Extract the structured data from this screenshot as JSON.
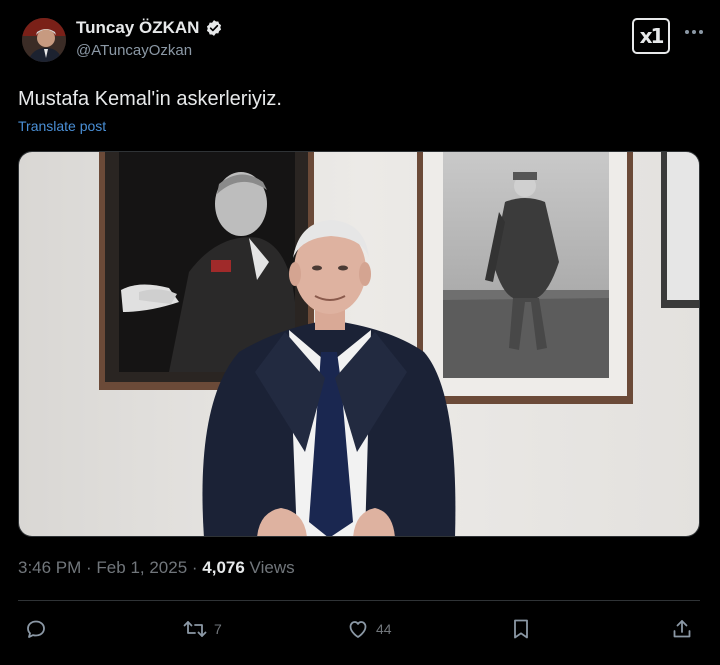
{
  "author": {
    "display_name": "Tuncay ÖZKAN",
    "handle": "@ATuncayOzkan",
    "verified": true,
    "verified_color": "#ffffff"
  },
  "header_actions": {
    "x_button_label": "x1",
    "more_icon": "more-icon"
  },
  "post": {
    "text": "Mustafa Kemal'in askerleriyiz.",
    "translate_label": "Translate post",
    "media_icon": "photo-of-man-in-suit"
  },
  "meta": {
    "time": "3:46 PM",
    "separator1": " · ",
    "date": "Feb 1, 2025",
    "separator2": " · ",
    "views_count": "4,076",
    "views_label": " Views"
  },
  "actions": {
    "reply_icon": "reply-icon",
    "repost_count": "7",
    "like_count": "44",
    "bookmark_icon": "bookmark-icon",
    "share_icon": "share-icon"
  },
  "colors": {
    "background": "#000000",
    "text_primary": "#e7e9ea",
    "text_secondary": "#71767b",
    "link": "#4a8fd6",
    "border": "#2f3336"
  }
}
